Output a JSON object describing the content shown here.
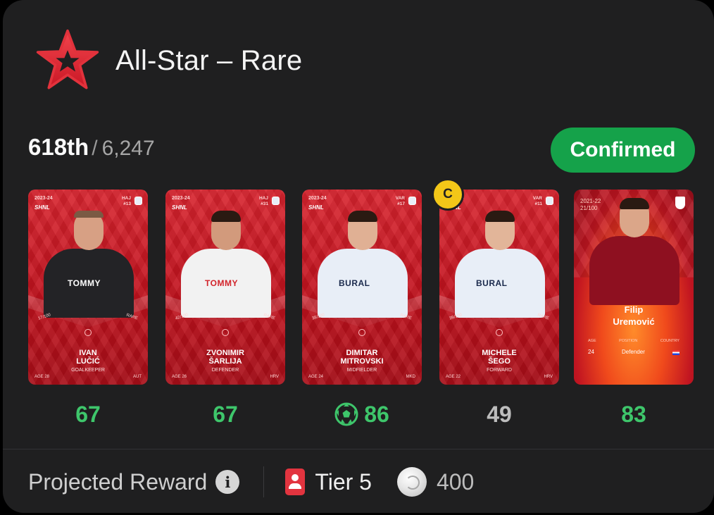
{
  "header": {
    "title": "All-Star – Rare",
    "logo": "star-icon"
  },
  "rank": {
    "position": "618th",
    "separator": "/",
    "total": "6,247"
  },
  "status": {
    "label": "Confirmed",
    "color": "#15a24a"
  },
  "captain": {
    "label": "C"
  },
  "cards": [
    {
      "season": "2023-24",
      "league": "SHNL",
      "club": "HAJ",
      "number": "#13",
      "serial": "17/100",
      "rarity": "RARE",
      "first": "IVAN",
      "last": "LUČIĆ",
      "position": "GOALKEEPER",
      "age": "AGE 28",
      "nat": "AUT",
      "sponsor": "TOMMY"
    },
    {
      "season": "2023-24",
      "league": "SHNL",
      "club": "HAJ",
      "number": "#31",
      "serial": "42/100",
      "rarity": "RARE",
      "first": "ZVONIMIR",
      "last": "ŠARLIJA",
      "position": "DEFENDER",
      "age": "AGE 26",
      "nat": "HRV",
      "sponsor": "TOMMY"
    },
    {
      "season": "2023-24",
      "league": "SHNL",
      "club": "VAR",
      "number": "#17",
      "serial": "38/100",
      "rarity": "RARE",
      "first": "DIMITAR",
      "last": "MITROVSKI",
      "position": "MIDFIELDER",
      "age": "AGE 24",
      "nat": "MKD",
      "sponsor": "BURAL"
    },
    {
      "season": "2023-24",
      "league": "SHNL",
      "club": "VAR",
      "number": "#11",
      "serial": "39/100",
      "rarity": "RARE",
      "first": "MICHELE",
      "last": "ŠEGO",
      "position": "FORWARD",
      "age": "AGE 22",
      "nat": "HRV",
      "sponsor": "BURAL"
    }
  ],
  "legacy_card": {
    "season": "2021-22",
    "serial": "21/100",
    "first": "Filip",
    "last": "Uremović",
    "head_age": "AGE",
    "head_position": "POSITION",
    "head_country": "COUNTRY",
    "age": "24",
    "position": "Defender"
  },
  "scores": [
    {
      "value": "67",
      "color": "#3ec66b"
    },
    {
      "value": "67",
      "color": "#3ec66b"
    },
    {
      "value": "86",
      "color": "#3ec66b",
      "icon": "soccer-ball-icon"
    },
    {
      "value": "49",
      "color": "#bdbdbd"
    },
    {
      "value": "83",
      "color": "#3ec66b"
    }
  ],
  "footer": {
    "projected_label": "Projected Reward",
    "info_icon": "info-icon",
    "info_glyph": "i",
    "tier_icon": "user-badge-icon",
    "tier": "Tier 5",
    "coin_icon": "coin-icon",
    "coins": "400"
  }
}
